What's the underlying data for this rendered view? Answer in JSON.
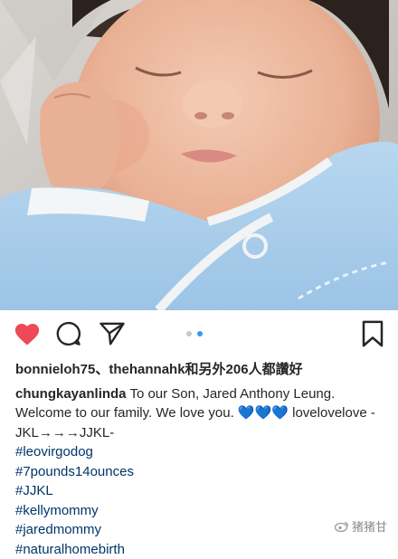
{
  "photo": {
    "alt": "sleeping newborn baby in blue onesie"
  },
  "actions": {
    "like_icon": "heart-filled-icon",
    "comment_icon": "comment-icon",
    "share_icon": "paper-plane-icon",
    "save_icon": "bookmark-icon",
    "like_color": "#ed4956",
    "carousel": {
      "count": 2,
      "active": 2,
      "active_color": "#3897f0"
    }
  },
  "likes": {
    "user1": "bonnieloh75",
    "separator": "、",
    "user2": "thehannahk",
    "rest": "和另外206人都讚好"
  },
  "caption": {
    "username": "chungkayanlinda",
    "text": "To our Son, Jared Anthony Leung. Welcome to our family.  We love you. 💙💙💙 lovelovelove -JKL→→→JJKL-",
    "hashtags": [
      "#leovirgodog",
      "#7pounds14ounces",
      "#JJKL",
      "#kellymommy",
      "#jaredmommy",
      "#naturalhomebirth"
    ]
  },
  "watermark": {
    "text": "猪猪甘"
  }
}
